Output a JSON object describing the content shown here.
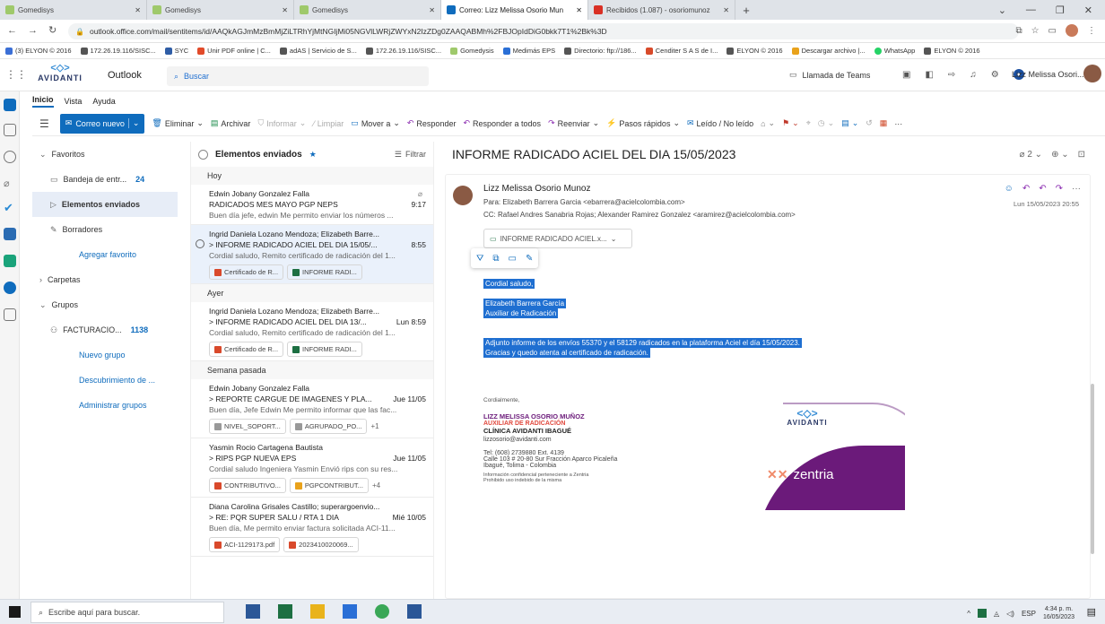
{
  "browser": {
    "tabs": [
      {
        "title": "Gomedisys",
        "close": "✕",
        "color": "#9fc96b"
      },
      {
        "title": "Gomedisys",
        "close": "✕",
        "color": "#9fc96b"
      },
      {
        "title": "Gomedisys",
        "close": "✕",
        "color": "#9fc96b"
      },
      {
        "title": "Correo: Lizz Melissa Osorio Mun",
        "close": "✕",
        "color": "#0f6cbd"
      },
      {
        "title": "Recibidos (1.087) - osoriomunoz",
        "close": "✕",
        "color": "#d93025"
      }
    ],
    "new_tab": "+",
    "url": "outlook.office.com/mail/sentitems/id/AAQkAGJmMzBmMjZiLTRhYjMtNGIjMi05NGVlLWRjZWYxN2IzZDg0ZAAQABMh%2FBJOpIdDiG0bkk7T1%2Bk%3D",
    "bookmarks": [
      "(3) ELYON © 2016",
      "172.26.19.116/SISC...",
      "SYC",
      "Unir PDF online | C...",
      "adAS | Servicio de S...",
      "172.26.19.116/SISC...",
      "Gomedysis",
      "Medimás EPS",
      "Directorio: ftp://186...",
      "Cenditer S A S de I...",
      "ELYON © 2016",
      "Descargar archivo |...",
      "WhatsApp",
      "ELYON © 2016"
    ]
  },
  "outlook": {
    "brand": "AVIDANTI",
    "app_name": "Outlook",
    "search_placeholder": "Buscar",
    "teams_call": "Llamada de Teams",
    "user_name": "Lizz Melissa Osori...",
    "ribbon_tabs": [
      "Inicio",
      "Vista",
      "Ayuda"
    ],
    "ribbon": {
      "new_mail": "Correo nuevo",
      "delete": "Eliminar",
      "archive": "Archivar",
      "report": "Informar",
      "clean": "Limpiar",
      "move": "Mover a",
      "reply": "Responder",
      "reply_all": "Responder a todos",
      "forward": "Reenviar",
      "quick_steps": "Pasos rápidos",
      "read_unread": "Leído / No leído"
    }
  },
  "nav": {
    "favorites": "Favoritos",
    "inbox": "Bandeja de entr...",
    "inbox_count": "24",
    "sent": "Elementos enviados",
    "drafts": "Borradores",
    "add_favorite": "Agregar favorito",
    "folders": "Carpetas",
    "groups": "Grupos",
    "facturacion": "FACTURACIO...",
    "facturacion_count": "1138",
    "new_group": "Nuevo grupo",
    "discover": "Descubrimiento de ...",
    "manage": "Administrar grupos"
  },
  "list": {
    "folder_title": "Elementos enviados",
    "filter": "Filtrar",
    "sections": [
      "Hoy",
      "Ayer",
      "Semana pasada"
    ],
    "messages": [
      {
        "from": "Edwin Jobany Gonzalez Falla",
        "subject": "RADICADOS MES MAYO PGP NEPS",
        "time": "9:17",
        "preview": "Buen día jefe, edwin Me permito enviar los números ...",
        "chips": []
      },
      {
        "from": "Ingrid Daniela Lozano Mendoza; Elizabeth Barre...",
        "subject": "> INFORME RADICADO ACIEL DEL DIA 15/05/...",
        "time": "8:55",
        "preview": "Cordial saludo, Remito certificado de radicación del 1...",
        "chips": [
          "Certificado de R...",
          "INFORME RADI..."
        ]
      },
      {
        "from": "Ingrid Daniela Lozano Mendoza; Elizabeth Barre...",
        "subject": "> INFORME RADICADO ACIEL DEL DIA 13/...",
        "time": "Lun 8:59",
        "preview": "Cordial saludo, Remito certificado de radicación del 1...",
        "chips": [
          "Certificado de R...",
          "INFORME RADI..."
        ]
      },
      {
        "from": "Edwin Jobany Gonzalez Falla",
        "subject": "> REPORTE CARGUE DE IMAGENES Y PLA...",
        "time": "Jue 11/05",
        "preview": "Buen día, Jefe Edwin Me permito informar que las fac...",
        "chips": [
          "NIVEL_SOPORT...",
          "AGRUPADO_PO...",
          "+1"
        ]
      },
      {
        "from": "Yasmin Rocio Cartagena Bautista",
        "subject": "> RIPS PGP NUEVA EPS",
        "time": "Jue 11/05",
        "preview": "Cordial saludo Ingeniera Yasmin Envió rips con su res...",
        "chips": [
          "CONTRIBUTIVO...",
          "PGPCONTRIBUT...",
          "+4"
        ]
      },
      {
        "from": "Diana Carolina Grisales Castillo; superargoenvio...",
        "subject": "> RE: PQR SUPER SALU / RTA 1 DIA",
        "time": "Mié 10/05",
        "preview": "Buen día, Me permito enviar factura solicitada ACI-11...",
        "chips": [
          "ACI-1129173.pdf",
          "2023410020069..."
        ]
      }
    ]
  },
  "reading": {
    "subject": "INFORME RADICADO ACIEL DEL DIA 15/05/2023",
    "attach_count": "2",
    "sender": "Lizz Melissa Osorio Munoz",
    "to_label": "Para:",
    "to": "Elizabeth Barrera Garcia <ebarrera@acielcolombia.com>",
    "cc_label": "CC:",
    "cc": "Rafael Andres Sanabria Rojas;  Alexander Ramirez Gonzalez <aramirez@acielcolombia.com>",
    "date": "Lun 15/05/2023 20:55",
    "attachment": "INFORME RADICADO ACIEL.x...",
    "body": [
      "Cordial saludo,",
      "Elizabeth Barrera García",
      "Auxiliar de Radicación",
      "Adjunto informe de los envíos 55370 y el 58129 radicados en la plataforma Aciel el día 15/05/2023.",
      "Gracias y quedo atenta al certificado de radicación."
    ],
    "sig_greeting": "Cordialmente,",
    "sig_name": "LIZZ MELISSA OSORIO MUÑOZ",
    "sig_role": "AUXILIAR DE RADICACIÓN",
    "sig_company": "CLÍNICA AVIDANTI IBAGUÉ",
    "sig_email": "lizzosorio@avidanti.com",
    "sig_tel": "Tel: (608) 2739880 Ext. 4139",
    "sig_address": "Calle 103 # 20-80 Sur Fracción Aparco Picaleña",
    "sig_city": "Ibagué, Tolima - Colombia",
    "sig_conf1": "Información confidencial perteneciente a Zentria",
    "sig_conf2": "Prohibido uso indebido de la misma",
    "banner_brand": "AVIDANTI",
    "banner_zentria": "zentria"
  },
  "taskbar": {
    "search_placeholder": "Escribe aquí para buscar.",
    "lang": "ESP",
    "time": "4:34 p. m.",
    "date": "16/05/2023"
  },
  "colors": {
    "accent": "#0f6cbd",
    "purple": "#6b1a7a",
    "selection": "#1f6fd1"
  }
}
